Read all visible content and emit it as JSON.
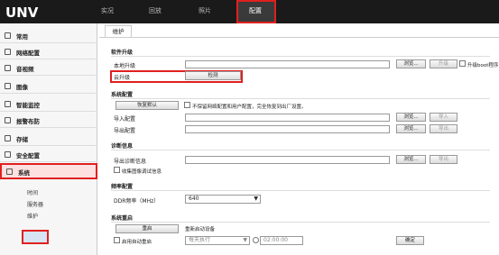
{
  "app": {
    "logo": "UNV"
  },
  "nav": [
    {
      "label": "实况"
    },
    {
      "label": "回放"
    },
    {
      "label": "照片"
    },
    {
      "label": "配置"
    }
  ],
  "sidebar": {
    "items": [
      {
        "label": "常用"
      },
      {
        "label": "网络配置"
      },
      {
        "label": "音视频"
      },
      {
        "label": "图像"
      },
      {
        "label": "智能监控"
      },
      {
        "label": "报警布防"
      },
      {
        "label": "存储"
      },
      {
        "label": "安全配置"
      },
      {
        "label": "系统"
      }
    ],
    "sub": [
      {
        "label": "时间"
      },
      {
        "label": "服务器"
      },
      {
        "label": "维护"
      }
    ]
  },
  "tab": "维护",
  "upgrade": {
    "title": "软件升级",
    "local_label": "本地升级",
    "browse": "浏览...",
    "upgrade": "升级",
    "boot_label": "升级boot程序",
    "cloud_label": "云升级",
    "detect": "检测"
  },
  "config": {
    "title": "系统配置",
    "restore": "恢复默认",
    "restore_note": "不保留网络配置和用户配置，完全恢复到出厂设置。",
    "import_label": "导入配置",
    "export_label": "导出配置",
    "browse": "浏览...",
    "import": "导入",
    "export": "导出"
  },
  "diag": {
    "title": "诊断信息",
    "export_label": "导出诊断信息",
    "browse": "浏览...",
    "export": "导出",
    "collect": "收集图像调试信息"
  },
  "freq": {
    "title": "频率配置",
    "ddr_label": "DDR频率（MHz）",
    "ddr_value": "640"
  },
  "reboot": {
    "title": "系统重启",
    "reboot_btn": "重启",
    "reboot_label": "重新启动设备",
    "auto_label": "启用自动重启",
    "period": "每天执行",
    "time": "02:00:00",
    "ok": "确定"
  },
  "icons": {
    "arrow": "▼"
  }
}
